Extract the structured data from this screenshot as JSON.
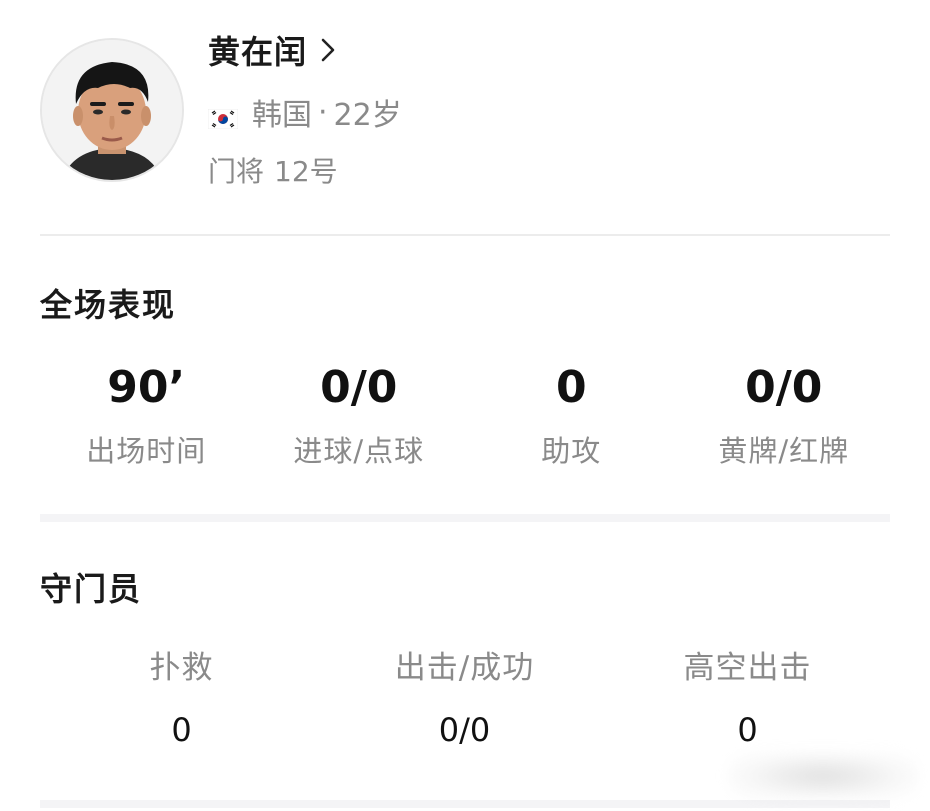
{
  "player": {
    "name": "黄在闰",
    "country": "韩国",
    "meta_separator": "·",
    "age": "22岁",
    "position": "门将",
    "number": "12号",
    "flag_icon": "south-korea-flag-icon",
    "profile_icon": "chevron-right-icon"
  },
  "overall": {
    "title": "全场表现",
    "stats": [
      {
        "value": "90’",
        "label": "出场时间"
      },
      {
        "value": "0/0",
        "label": "进球/点球"
      },
      {
        "value": "0",
        "label": "助攻"
      },
      {
        "value": "0/0",
        "label": "黄牌/红牌"
      }
    ]
  },
  "goalkeeper": {
    "title": "守门员",
    "stats": [
      {
        "label": "扑救",
        "value": "0"
      },
      {
        "label": "出击/成功",
        "value": "0/0"
      },
      {
        "label": "高空出击",
        "value": "0"
      }
    ]
  },
  "colors": {
    "primary_text": "#1a1a1a",
    "secondary_text": "#8a8a8a",
    "divider": "#ececec",
    "section_gap": "#f4f4f6"
  }
}
